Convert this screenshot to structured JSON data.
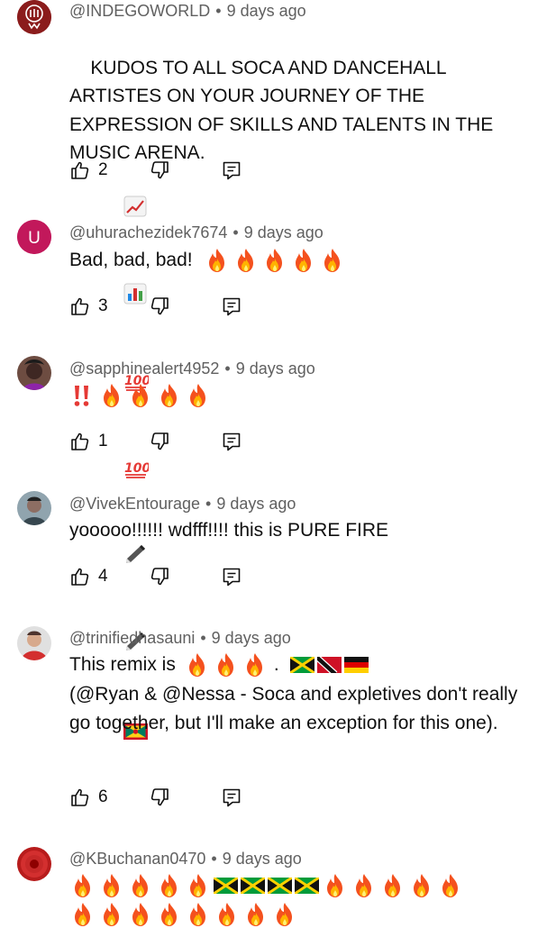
{
  "comments": [
    {
      "handle": "@INDEGOWORLD",
      "separator": "•",
      "time": "9 days ago",
      "text": "KUDOS TO ALL SOCA AND DANCEHALL ARTISTES ON YOUR JOURNEY OF THE EXPRESSION OF SKILLS AND TALENTS IN THE MUSIC ARENA.",
      "emojis": [
        "chart-increasing-icon",
        "bar-chart-icon",
        "hundred-points-icon",
        "hundred-points-icon",
        "pen-icon",
        "pen-icon",
        "grenada-flag-icon"
      ],
      "likes": "2",
      "avatar_color": "#8b1c1c"
    },
    {
      "handle": "@uhurachezidek7674",
      "separator": "•",
      "time": "9 days ago",
      "text": "Bad, bad, bad!",
      "emojis": [
        "fire-icon",
        "fire-icon",
        "fire-icon",
        "fire-icon",
        "fire-icon"
      ],
      "likes": "3",
      "avatar_letter": "U",
      "avatar_color": "#c2185b"
    },
    {
      "handle": "@sapphinealert4952",
      "separator": "•",
      "time": "9 days ago",
      "text": "",
      "emojis": [
        "double-exclamation-icon",
        "fire-icon",
        "fire-icon",
        "fire-icon",
        "fire-icon"
      ],
      "likes": "1"
    },
    {
      "handle": "@VivekEntourage",
      "separator": "•",
      "time": "9 days ago",
      "text": "yooooo!!!!!! wdfff!!!! this is PURE FIRE",
      "likes": "4"
    },
    {
      "handle": "@trinifiedhasauni",
      "separator": "•",
      "time": "9 days ago",
      "text_line1": "This remix is",
      "text_rest": "(@Ryan & @Nessa - Soca and expletives don't really go together, but I'll make an exception for this one).",
      "emojis": [
        "fire-icon",
        "fire-icon",
        "fire-icon",
        "jamaica-flag-icon",
        "trinidad-flag-icon",
        "germany-flag-icon"
      ],
      "likes": "6"
    },
    {
      "handle": "@KBuchanan0470",
      "separator": "•",
      "time": "9 days ago",
      "emojis": [
        "fire-icon",
        "jamaica-flag-icon"
      ]
    }
  ],
  "colors": {
    "meta": "#606060",
    "text": "#0f0f0f",
    "icon": "#0f0f0f"
  }
}
